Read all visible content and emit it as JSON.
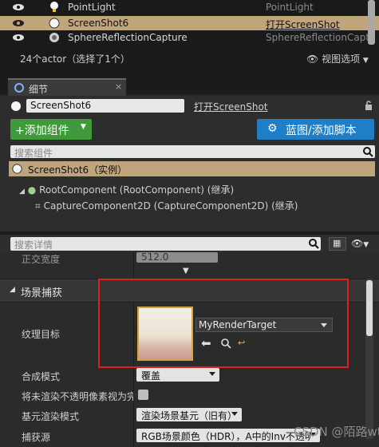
{
  "outliner": {
    "rows": [
      {
        "name": "PointLight",
        "type": "PointLight",
        "selected": false
      },
      {
        "name": "ScreenShot6",
        "type": "打开ScreenShot",
        "selected": true
      },
      {
        "name": "SphereReflectionCapture",
        "type": "SphereReflectionCapture",
        "selected": false
      }
    ],
    "actor_count": "24个actor（选择了1个）",
    "view_options": "视图选项"
  },
  "details_tab": {
    "label": "细节",
    "close": "×"
  },
  "actor": {
    "name": "ScreenShot6",
    "open_link": "打开ScreenShot",
    "add_component": "+添加组件",
    "blueprint_button": "蓝图/添加脚本",
    "search_components_placeholder": "搜索组件",
    "selected_component": "ScreenShot6（实例）",
    "root_component": "RootComponent (RootComponent) (继承)",
    "capture_component": "CaptureComponent2D (CaptureComponent2D) (继承)"
  },
  "details": {
    "search_placeholder": "搜索详情",
    "ortho_label": "正交宽度",
    "ortho_value": "512.0",
    "category": "场景捕获",
    "texture_target_label": "纹理目标",
    "texture_target_value": "MyRenderTarget",
    "composite_mode_label": "合成模式",
    "composite_mode_value": "覆盖",
    "opaque_label": "将未渲染不透明像素视为完整",
    "primitive_mode_label": "基元渲染模式",
    "primitive_mode_value": "渲染场景基元（旧有）",
    "capture_source_label": "捕获源",
    "capture_source_value": "RGB场景颜色（HDR），A中的Inv不透明度"
  },
  "watermark": "CSDN @陌路wt",
  "colors": {
    "selection": "#c0a57c",
    "green": "#3f9a3a",
    "blue": "#1e7ec8",
    "highlight_box": "#e02020"
  }
}
